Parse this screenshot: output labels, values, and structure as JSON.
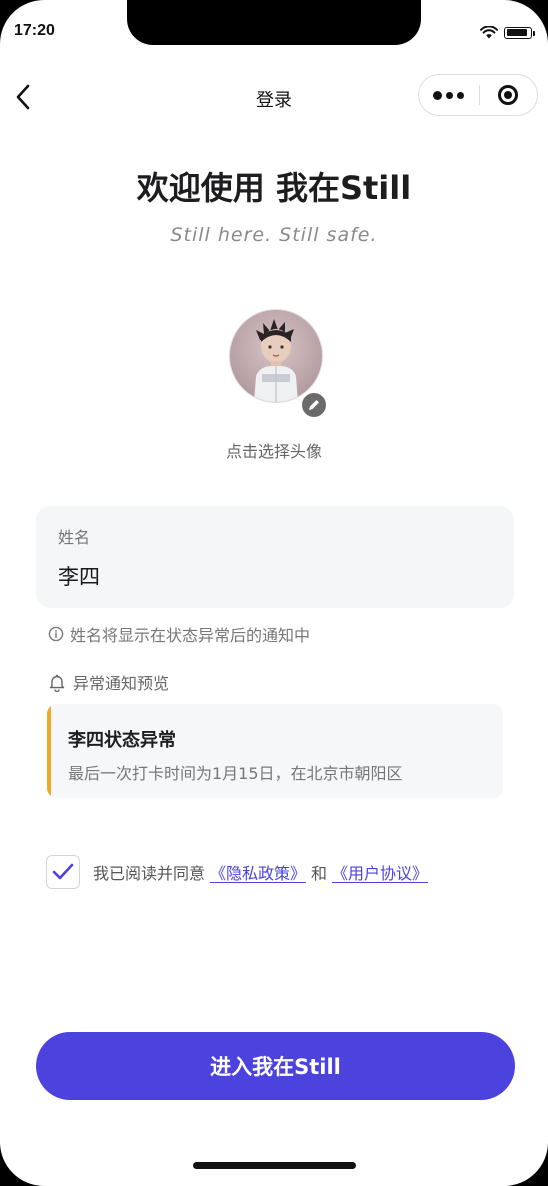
{
  "status_bar": {
    "time": "17:20"
  },
  "nav": {
    "title": "登录"
  },
  "header": {
    "welcome": "欢迎使用 我在Still",
    "tagline": "Still here. Still safe."
  },
  "avatar": {
    "hint": "点击选择头像"
  },
  "name_field": {
    "label": "姓名",
    "value": "李四",
    "hint": "姓名将显示在状态异常后的通知中"
  },
  "preview": {
    "title": "异常通知预览",
    "notice_title": "李四状态异常",
    "notice_body": "最后一次打卡时间为1月15日，在北京市朝阳区"
  },
  "agreement": {
    "checked": true,
    "prefix": "我已阅读并同意",
    "privacy_link": "《隐私政策》",
    "and": "和",
    "terms_link": "《用户协议》"
  },
  "cta": {
    "label": "进入我在Still"
  },
  "colors": {
    "primary": "#4c43df",
    "accent_bar": "#f0a92a",
    "link": "#4a44de"
  }
}
